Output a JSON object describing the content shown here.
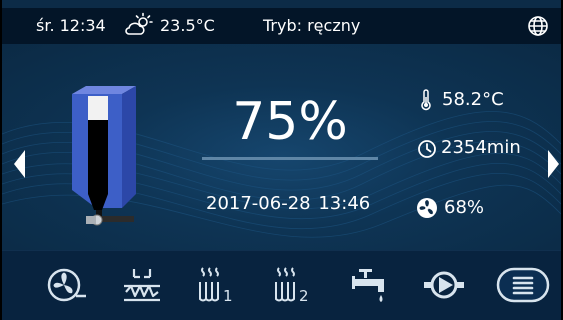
{
  "status_bar": {
    "day_time": "śr. 12:34",
    "weather_icon": "partly-cloudy-icon",
    "outdoor_temp": "23.5°C",
    "mode": "Tryb: ręczny",
    "globe_icon": "globe-icon"
  },
  "main": {
    "feeder_level_percent": 75,
    "feeder_level_label": "75%",
    "date": "2017-06-28",
    "time": "13:46",
    "readouts": {
      "temperature": {
        "icon": "thermometer-icon",
        "value": "58.2°C"
      },
      "time": {
        "icon": "clock-icon",
        "value": "2354min"
      },
      "fan": {
        "icon": "fan-icon",
        "value": "68%"
      }
    },
    "nav": {
      "left_icon": "arrow-left-icon",
      "right_icon": "arrow-right-icon"
    }
  },
  "bottom_bar": {
    "buttons": [
      {
        "id": "fan",
        "icon": "fan-icon"
      },
      {
        "id": "heater",
        "icon": "heating-element-icon"
      },
      {
        "id": "heating-circuit-1",
        "icon": "radiator-icon",
        "label": "1"
      },
      {
        "id": "heating-circuit-2",
        "icon": "radiator-icon",
        "label": "2"
      },
      {
        "id": "tap",
        "icon": "water-tap-icon"
      },
      {
        "id": "pump",
        "icon": "pump-icon"
      },
      {
        "id": "menu",
        "icon": "menu-icon"
      }
    ]
  },
  "colors": {
    "background": "#0c2b47",
    "status_bar": "#031528",
    "bottom_bar": "#08233f",
    "icon_light": "#d8e4ee",
    "accent_blue": "#3d5fc7"
  }
}
